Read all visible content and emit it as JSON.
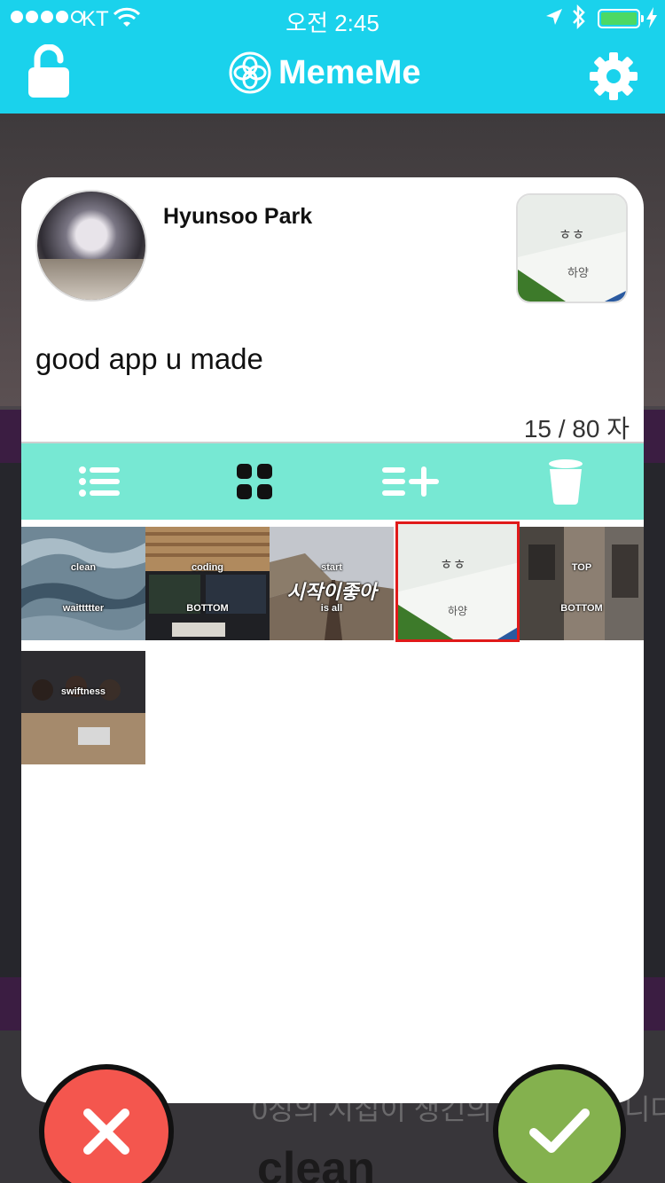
{
  "status_bar": {
    "carrier": "KT",
    "time": "오전 2:45"
  },
  "app": {
    "title": "MemeMe",
    "colors": {
      "header": "#1ad2ec",
      "toolbar": "#77e8d3",
      "cancel": "#f4564e",
      "confirm": "#84b14e",
      "selection": "#e01a1a"
    }
  },
  "background_feed": {
    "texts": [
      "0징의 시집이 생긴의 Me",
      "니다",
      "clean"
    ]
  },
  "card": {
    "user_name": "Hyunsoo Park",
    "message": "good app u made",
    "counter": "15 / 80 자",
    "toolbar_icons": [
      "list-icon",
      "grid-icon",
      "add-list-icon",
      "trash-icon"
    ],
    "active_tool": "grid-icon"
  },
  "memes": [
    {
      "top": "clean",
      "bottom": "waittttter",
      "selected": false
    },
    {
      "top": "coding",
      "bottom": "BOTTOM",
      "selected": false
    },
    {
      "top": "start",
      "bottom": "is all",
      "overlay": "시작이좋아",
      "selected": false
    },
    {
      "top": "",
      "bottom": "",
      "overlay": "하양",
      "selected": true
    },
    {
      "top": "TOP",
      "bottom": "BOTTOM",
      "selected": false
    },
    {
      "top": "swiftness",
      "bottom": "",
      "selected": false
    }
  ]
}
